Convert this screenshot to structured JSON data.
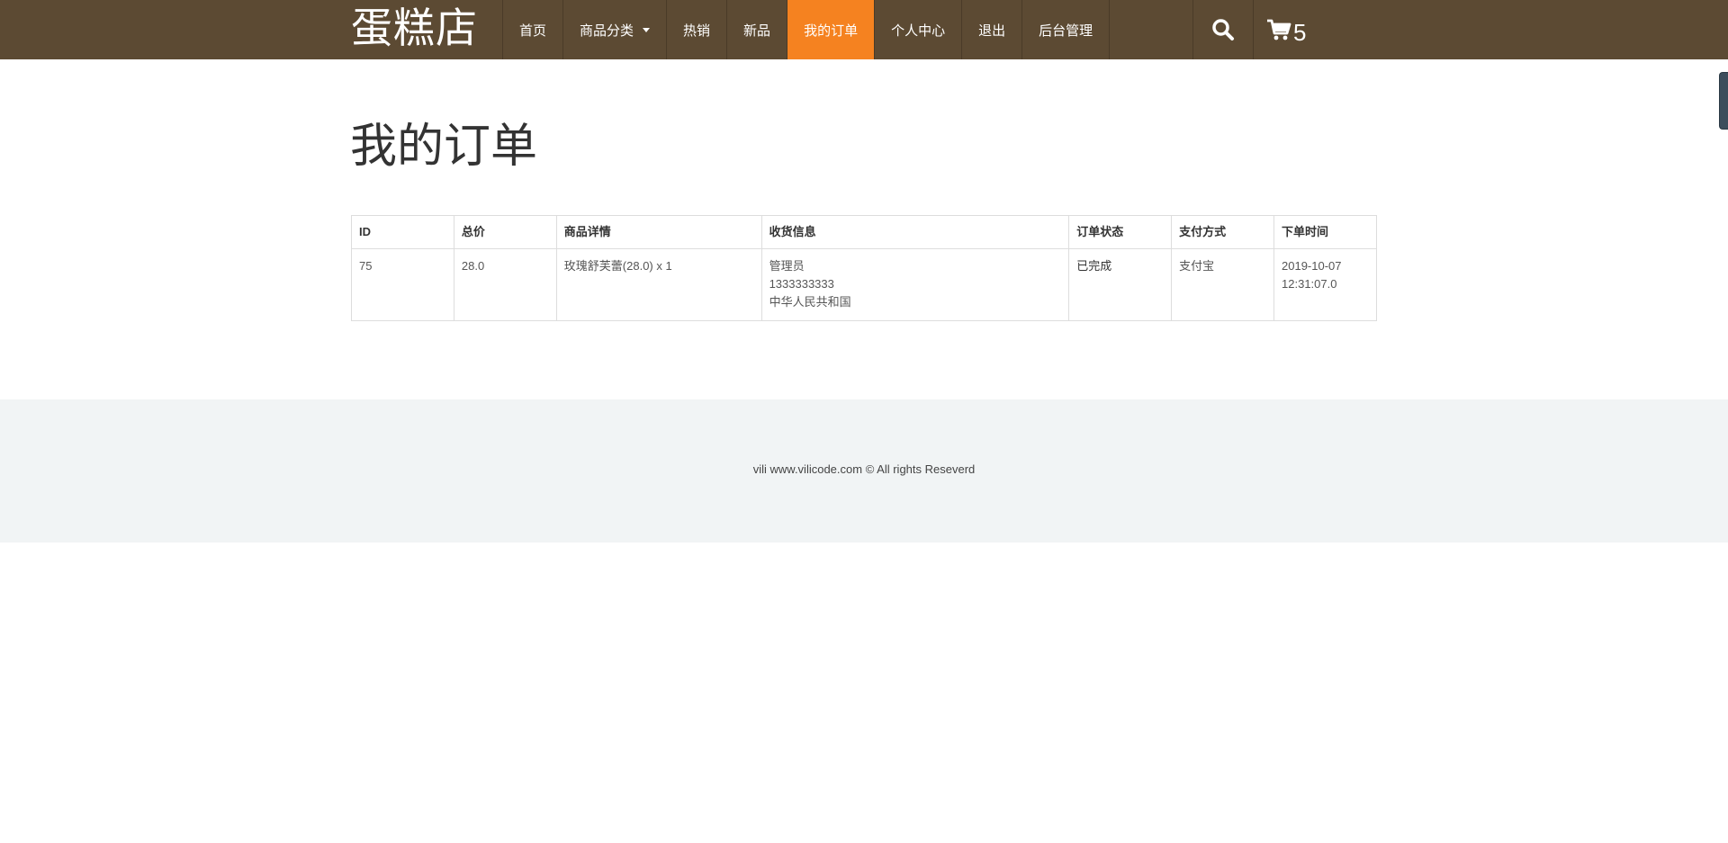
{
  "brand": "蛋糕店",
  "nav": {
    "items": [
      {
        "label": "首页"
      },
      {
        "label": "商品分类"
      },
      {
        "label": "热销"
      },
      {
        "label": "新品"
      },
      {
        "label": "我的订单"
      },
      {
        "label": "个人中心"
      },
      {
        "label": "退出"
      },
      {
        "label": "后台管理"
      }
    ],
    "active": "我的订单",
    "cart_count": "5",
    "icons": [
      "search-icon",
      "cart-icon",
      "caret-down-icon"
    ]
  },
  "page_title": "我的订单",
  "orders": {
    "columns": [
      "ID",
      "总价",
      "商品详情",
      "收货信息",
      "订单状态",
      "支付方式",
      "下单时间"
    ],
    "rows": [
      {
        "id": "75",
        "total": "28.0",
        "items": "玫瑰舒芙蕾(28.0) x 1",
        "shipping": {
          "name": "管理员",
          "phone": "1333333333",
          "address": "中华人民共和国"
        },
        "status": "已完成",
        "payment": "支付宝",
        "date": "2019-10-07",
        "time": "12:31:07.0"
      }
    ]
  },
  "footer": {
    "text": "vili www.vilicode.com © All rights Reseverd"
  },
  "colors": {
    "navbar": "#5c4a33",
    "active": "#f58220",
    "footer": "#f1f4f5"
  }
}
